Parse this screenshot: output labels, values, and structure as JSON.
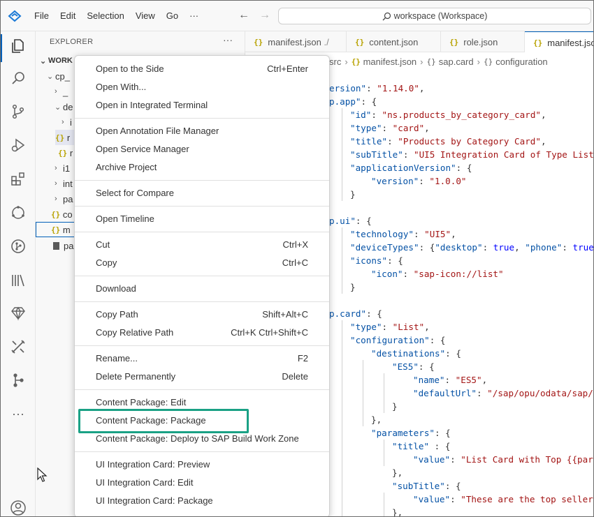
{
  "titlebar": {
    "menu": [
      "File",
      "Edit",
      "Selection",
      "View",
      "Go",
      "···"
    ],
    "search_text": "workspace (Workspace)"
  },
  "sidebar": {
    "title": "EXPLORER",
    "more": "···",
    "tree": [
      {
        "label": "WORK",
        "kind": "folder-open"
      },
      {
        "label": "cp_",
        "kind": "folder-open"
      },
      {
        "label": "_",
        "kind": "folder"
      },
      {
        "label": "de",
        "kind": "folder-open"
      },
      {
        "label": "i",
        "kind": "folder"
      },
      {
        "label": "r",
        "kind": "json"
      },
      {
        "label": "r",
        "kind": "json"
      },
      {
        "label": "i1",
        "kind": "folder"
      },
      {
        "label": "int",
        "kind": "folder"
      },
      {
        "label": "pa",
        "kind": "folder"
      },
      {
        "label": "co",
        "kind": "json"
      },
      {
        "label": "m",
        "kind": "json"
      },
      {
        "label": "pa",
        "kind": "file"
      }
    ]
  },
  "tabs": [
    {
      "label": "manifest.json",
      "suffix": "./"
    },
    {
      "label": "content.json",
      "suffix": ""
    },
    {
      "label": "role.json",
      "suffix": ""
    },
    {
      "label": "manifest.json",
      "suffix": ""
    }
  ],
  "breadcrumbs": [
    "src",
    "manifest.json",
    "sap.card",
    "configuration"
  ],
  "context_menu": {
    "groups": [
      [
        {
          "label": "Open to the Side",
          "shortcut": "Ctrl+Enter"
        },
        {
          "label": "Open With...",
          "shortcut": ""
        },
        {
          "label": "Open in Integrated Terminal",
          "shortcut": ""
        }
      ],
      [
        {
          "label": "Open Annotation File Manager",
          "shortcut": ""
        },
        {
          "label": "Open Service Manager",
          "shortcut": ""
        },
        {
          "label": "Archive Project",
          "shortcut": ""
        }
      ],
      [
        {
          "label": "Select for Compare",
          "shortcut": ""
        }
      ],
      [
        {
          "label": "Open Timeline",
          "shortcut": ""
        }
      ],
      [
        {
          "label": "Cut",
          "shortcut": "Ctrl+X"
        },
        {
          "label": "Copy",
          "shortcut": "Ctrl+C"
        }
      ],
      [
        {
          "label": "Download",
          "shortcut": ""
        }
      ],
      [
        {
          "label": "Copy Path",
          "shortcut": "Shift+Alt+C"
        },
        {
          "label": "Copy Relative Path",
          "shortcut": "Ctrl+K Ctrl+Shift+C"
        }
      ],
      [
        {
          "label": "Rename...",
          "shortcut": "F2"
        },
        {
          "label": "Delete Permanently",
          "shortcut": "Delete"
        }
      ],
      [
        {
          "label": "Content Package: Edit",
          "shortcut": ""
        },
        {
          "label": "Content Package: Package",
          "shortcut": "",
          "highlighted": true
        },
        {
          "label": "Content Package: Deploy to SAP Build Work Zone",
          "shortcut": ""
        }
      ],
      [
        {
          "label": "UI Integration Card: Preview",
          "shortcut": ""
        },
        {
          "label": "UI Integration Card: Edit",
          "shortcut": ""
        },
        {
          "label": "UI Integration Card: Package",
          "shortcut": ""
        }
      ]
    ]
  },
  "code": [
    {
      "indent": 0,
      "tokens": [
        [
          "k",
          "ersion\""
        ],
        [
          "p",
          ": "
        ],
        [
          "s",
          "\"1.14.0\""
        ],
        [
          "p",
          ","
        ]
      ]
    },
    {
      "indent": 0,
      "tokens": [
        [
          "k",
          "p.app\""
        ],
        [
          "p",
          ": {"
        ]
      ]
    },
    {
      "indent": 1,
      "tokens": [
        [
          "k",
          "\"id\""
        ],
        [
          "p",
          ": "
        ],
        [
          "s",
          "\"ns.products_by_category_card\""
        ],
        [
          "p",
          ","
        ]
      ]
    },
    {
      "indent": 1,
      "tokens": [
        [
          "k",
          "\"type\""
        ],
        [
          "p",
          ": "
        ],
        [
          "s",
          "\"card\""
        ],
        [
          "p",
          ","
        ]
      ]
    },
    {
      "indent": 1,
      "tokens": [
        [
          "k",
          "\"title\""
        ],
        [
          "p",
          ": "
        ],
        [
          "s",
          "\"Products by Category Card\""
        ],
        [
          "p",
          ","
        ]
      ]
    },
    {
      "indent": 1,
      "tokens": [
        [
          "k",
          "\"subTitle\""
        ],
        [
          "p",
          ": "
        ],
        [
          "s",
          "\"UI5 Integration Card of Type List\""
        ],
        [
          "p",
          ","
        ]
      ]
    },
    {
      "indent": 1,
      "tokens": [
        [
          "k",
          "\"applicationVersion\""
        ],
        [
          "p",
          ": {"
        ]
      ]
    },
    {
      "indent": 2,
      "tokens": [
        [
          "k",
          "\"version\""
        ],
        [
          "p",
          ": "
        ],
        [
          "s",
          "\"1.0.0\""
        ]
      ]
    },
    {
      "indent": 1,
      "tokens": [
        [
          "p",
          "}"
        ]
      ]
    },
    {
      "indent": 0,
      "tokens": []
    },
    {
      "indent": 0,
      "tokens": [
        [
          "k",
          "p.ui\""
        ],
        [
          "p",
          ": {"
        ]
      ]
    },
    {
      "indent": 1,
      "tokens": [
        [
          "k",
          "\"technology\""
        ],
        [
          "p",
          ": "
        ],
        [
          "s",
          "\"UI5\""
        ],
        [
          "p",
          ","
        ]
      ]
    },
    {
      "indent": 1,
      "tokens": [
        [
          "k",
          "\"deviceTypes\""
        ],
        [
          "p",
          ": {"
        ],
        [
          "k",
          "\"desktop\""
        ],
        [
          "p",
          ": "
        ],
        [
          "b",
          "true"
        ],
        [
          "p",
          ", "
        ],
        [
          "k",
          "\"phone\""
        ],
        [
          "p",
          ": "
        ],
        [
          "b",
          "true"
        ],
        [
          "p",
          ","
        ]
      ]
    },
    {
      "indent": 1,
      "tokens": [
        [
          "k",
          "\"icons\""
        ],
        [
          "p",
          ": {"
        ]
      ]
    },
    {
      "indent": 2,
      "tokens": [
        [
          "k",
          "\"icon\""
        ],
        [
          "p",
          ": "
        ],
        [
          "s",
          "\"sap-icon://list\""
        ]
      ]
    },
    {
      "indent": 1,
      "tokens": [
        [
          "p",
          "}"
        ]
      ]
    },
    {
      "indent": 0,
      "tokens": []
    },
    {
      "indent": 0,
      "tokens": [
        [
          "k",
          "p.card\""
        ],
        [
          "p",
          ": {"
        ]
      ]
    },
    {
      "indent": 1,
      "tokens": [
        [
          "k",
          "\"type\""
        ],
        [
          "p",
          ": "
        ],
        [
          "s",
          "\"List\""
        ],
        [
          "p",
          ","
        ]
      ]
    },
    {
      "indent": 1,
      "tokens": [
        [
          "k",
          "\"configuration\""
        ],
        [
          "p",
          ": {"
        ]
      ]
    },
    {
      "indent": 2,
      "tokens": [
        [
          "k",
          "\"destinations\""
        ],
        [
          "p",
          ": {"
        ]
      ]
    },
    {
      "indent": 3,
      "tokens": [
        [
          "k",
          "\"ES5\""
        ],
        [
          "p",
          ": {"
        ]
      ]
    },
    {
      "indent": 4,
      "tokens": [
        [
          "k",
          "\"name\""
        ],
        [
          "p",
          ": "
        ],
        [
          "s",
          "\"ES5\""
        ],
        [
          "p",
          ","
        ]
      ]
    },
    {
      "indent": 4,
      "tokens": [
        [
          "k",
          "\"defaultUrl\""
        ],
        [
          "p",
          ": "
        ],
        [
          "s",
          "\"/sap/opu/odata/sap/EPM"
        ]
      ]
    },
    {
      "indent": 3,
      "tokens": [
        [
          "p",
          "}"
        ]
      ]
    },
    {
      "indent": 2,
      "tokens": [
        [
          "p",
          "},"
        ]
      ]
    },
    {
      "indent": 2,
      "tokens": [
        [
          "k",
          "\"parameters\""
        ],
        [
          "p",
          ": {"
        ]
      ]
    },
    {
      "indent": 3,
      "tokens": [
        [
          "k",
          "\"title\""
        ],
        [
          "p",
          " : {"
        ]
      ]
    },
    {
      "indent": 4,
      "tokens": [
        [
          "k",
          "\"value\""
        ],
        [
          "p",
          ": "
        ],
        [
          "s",
          "\"List Card with Top {{param"
        ]
      ]
    },
    {
      "indent": 3,
      "tokens": [
        [
          "p",
          "},"
        ]
      ]
    },
    {
      "indent": 3,
      "tokens": [
        [
          "k",
          "\"subTitle\""
        ],
        [
          "p",
          ": {"
        ]
      ]
    },
    {
      "indent": 4,
      "tokens": [
        [
          "k",
          "\"value\""
        ],
        [
          "p",
          ": "
        ],
        [
          "s",
          "\"These are the top sellers"
        ]
      ]
    },
    {
      "indent": 3,
      "tokens": [
        [
          "p",
          "},"
        ]
      ]
    }
  ],
  "colors": {
    "accent": "#005fb8",
    "highlight_box": "#1aa185",
    "json_key": "#0451a5",
    "json_string": "#a31515",
    "json_bool": "#0000ff"
  }
}
